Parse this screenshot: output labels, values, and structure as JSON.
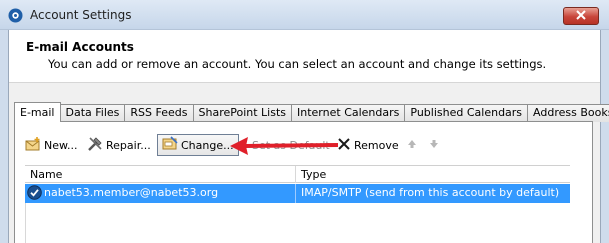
{
  "window": {
    "title": "Account Settings"
  },
  "header": {
    "title": "E-mail Accounts",
    "description": "You can add or remove an account. You can select an account and change its settings."
  },
  "tabs": [
    {
      "label": "E-mail",
      "active": true
    },
    {
      "label": "Data Files"
    },
    {
      "label": "RSS Feeds"
    },
    {
      "label": "SharePoint Lists"
    },
    {
      "label": "Internet Calendars"
    },
    {
      "label": "Published Calendars"
    },
    {
      "label": "Address Books"
    }
  ],
  "toolbar": {
    "new_label": "New...",
    "repair_label": "Repair...",
    "change_label": "Change...",
    "set_default_label": "Set as Default",
    "remove_label": "Remove"
  },
  "table": {
    "columns": [
      "Name",
      "Type"
    ],
    "rows": [
      {
        "name": "nabet53.member@nabet53.org",
        "type": "IMAP/SMTP (send from this account by default)",
        "selected": true
      }
    ]
  },
  "colors": {
    "selection": "#3399ff",
    "annotation_arrow": "#e0202a",
    "close_button": "#c8453a"
  }
}
